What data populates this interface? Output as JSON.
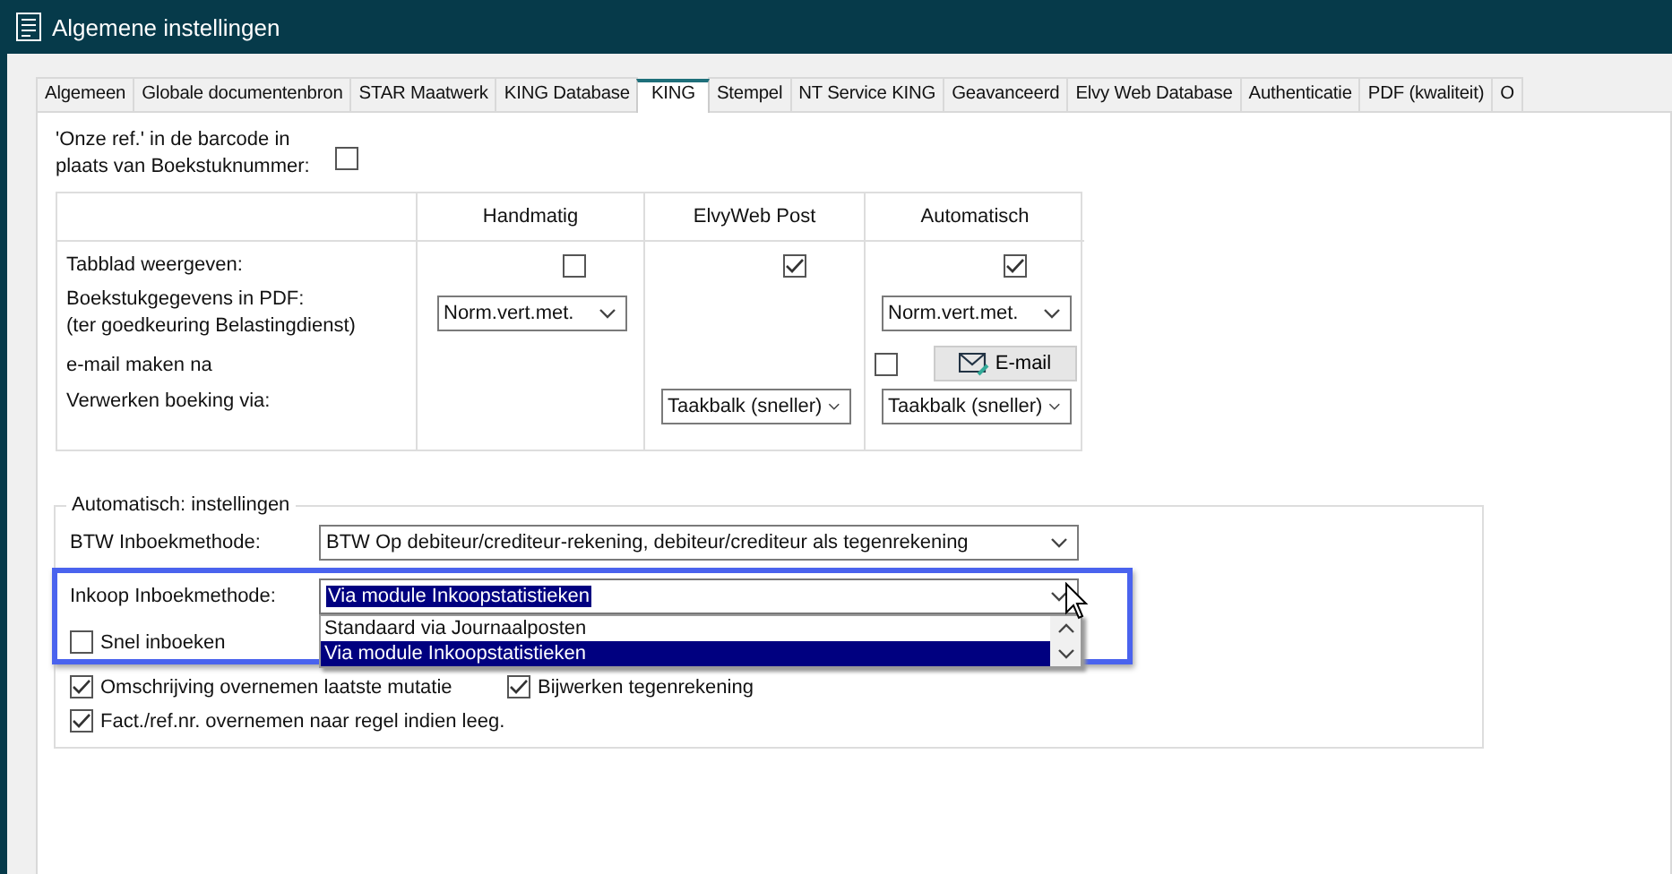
{
  "window": {
    "title": "Algemene instellingen"
  },
  "tabs": [
    {
      "label": "Algemeen",
      "selected": false
    },
    {
      "label": "Globale documentenbron",
      "selected": false
    },
    {
      "label": "STAR Maatwerk",
      "selected": false
    },
    {
      "label": "KING Database",
      "selected": false
    },
    {
      "label": "KING",
      "selected": true
    },
    {
      "label": "Stempel",
      "selected": false
    },
    {
      "label": "NT Service KING",
      "selected": false
    },
    {
      "label": "Geavanceerd",
      "selected": false
    },
    {
      "label": "Elvy Web Database",
      "selected": false
    },
    {
      "label": "Authenticatie",
      "selected": false
    },
    {
      "label": "PDF (kwaliteit)",
      "selected": false
    },
    {
      "label": "O",
      "selected": false
    }
  ],
  "barcode_option": {
    "label": "'Onze ref.' in de barcode in plaats van Boekstuknummer:",
    "checked": false
  },
  "grid": {
    "columns": [
      "Handmatig",
      "ElvyWeb Post",
      "Automatisch"
    ],
    "rows": [
      {
        "label": "Tabblad weergeven:",
        "cells": [
          {
            "kind": "checkbox",
            "checked": false
          },
          {
            "kind": "checkbox",
            "checked": true
          },
          {
            "kind": "checkbox",
            "checked": true
          }
        ]
      },
      {
        "label": "Boekstukgegevens in PDF:",
        "sublabel": "(ter goedkeuring Belastingdienst)",
        "cells": [
          {
            "kind": "dropdown",
            "value": "Norm.vert.met."
          },
          {
            "kind": "empty"
          },
          {
            "kind": "dropdown",
            "value": "Norm.vert.met."
          }
        ]
      },
      {
        "label": "e-mail maken na",
        "cells": [
          {
            "kind": "empty"
          },
          {
            "kind": "empty"
          },
          {
            "kind": "email",
            "checked": false,
            "button": "E-mail"
          }
        ]
      },
      {
        "label": "Verwerken boeking via:",
        "cells": [
          {
            "kind": "empty"
          },
          {
            "kind": "dropdown",
            "value": "Taakbalk (sneller)"
          },
          {
            "kind": "dropdown",
            "value": "Taakbalk (sneller)"
          }
        ]
      }
    ]
  },
  "automatic_settings": {
    "title": "Automatisch: instellingen",
    "btw": {
      "label": "BTW Inboekmethode:",
      "value": "BTW Op debiteur/crediteur-rekening, debiteur/crediteur als tegenrekening"
    },
    "inkoop": {
      "label": "Inkoop Inboekmethode:",
      "value": "Via module Inkoopstatistieken",
      "expanded": true,
      "options": [
        {
          "label": "Standaard via Journaalposten",
          "selected": false
        },
        {
          "label": "Via module Inkoopstatistieken",
          "selected": true
        }
      ]
    },
    "check_rows": [
      [
        {
          "label": "Snel inboeken",
          "checked": false
        }
      ],
      [
        {
          "label": "Omschrijving overnemen laatste mutatie",
          "checked": true
        },
        {
          "label": "Bijwerken tegenrekening",
          "checked": true
        }
      ],
      [
        {
          "label": "Fact./ref.nr. overnemen naar regel indien leeg.",
          "checked": true
        }
      ]
    ]
  }
}
